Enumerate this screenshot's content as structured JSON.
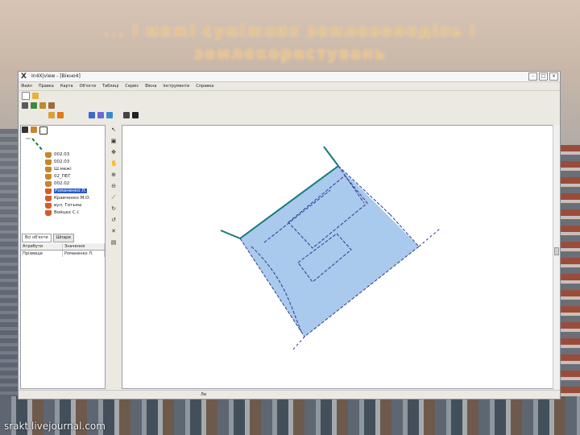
{
  "slide": {
    "headline_line1": "... і межі суміжних землеволодінь і",
    "headline_line2": "землекористувань",
    "watermark": "srakt.livejournal.com"
  },
  "window": {
    "title": "In4X|view - [Вікно4]",
    "app_icon": "X",
    "buttons": [
      "minimize-icon",
      "maximize-icon",
      "close-icon"
    ]
  },
  "menu": {
    "items": [
      "Файл",
      "Правка",
      "Карта",
      "Об'єкти",
      "Таблиці",
      "Сервіс",
      "Вікна",
      "Інструменти",
      "Справка"
    ]
  },
  "left_panel": {
    "tree_items": [
      {
        "label": "002.03",
        "selected": false
      },
      {
        "label": "002.03",
        "selected": false
      },
      {
        "label": "Ш.межі",
        "selected": false
      },
      {
        "label": "02_ПЕГ",
        "selected": false
      },
      {
        "label": "002.02",
        "selected": false
      },
      {
        "label": "Романенко Л.",
        "selected": true
      },
      {
        "label": "Кравченко М.О.",
        "selected": false
      },
      {
        "label": "вул. Гетьма",
        "selected": false
      },
      {
        "label": "Войцех С.І.",
        "selected": false
      }
    ],
    "tabs": [
      "Всі об'єкти",
      "Шпари"
    ],
    "grid": {
      "headers": [
        "Атрибути",
        "Значення"
      ],
      "rows": [
        [
          "Прізвище",
          "Романенко Л."
        ]
      ]
    }
  },
  "statusbar": {
    "text_left": "",
    "text_mid": "Ли"
  },
  "colors": {
    "parcel_fill": "#a9c9ed",
    "boundary_solid": "#157a78",
    "boundary_dashed": "#2b3b8f",
    "selection": "#2d57c9",
    "headline": "#e6c38e"
  }
}
